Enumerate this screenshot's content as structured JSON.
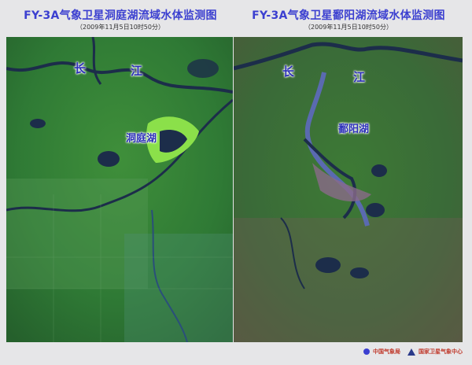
{
  "left": {
    "title": "FY-3A气象卫星洞庭湖流域水体监测图",
    "timestamp": "（2009年11月5日10时50分）",
    "labels": {
      "chang": "长",
      "jiang": "江",
      "lake": "洞庭湖"
    }
  },
  "right": {
    "title": "FY-3A气象卫星鄱阳湖流域水体监测图",
    "timestamp": "（2009年11月5日10时50分）",
    "labels": {
      "chang": "长",
      "jiang": "江",
      "lake": "鄱阳湖"
    }
  },
  "footer": {
    "org1": "中国气象局",
    "org2": "国家卫星气象中心"
  }
}
